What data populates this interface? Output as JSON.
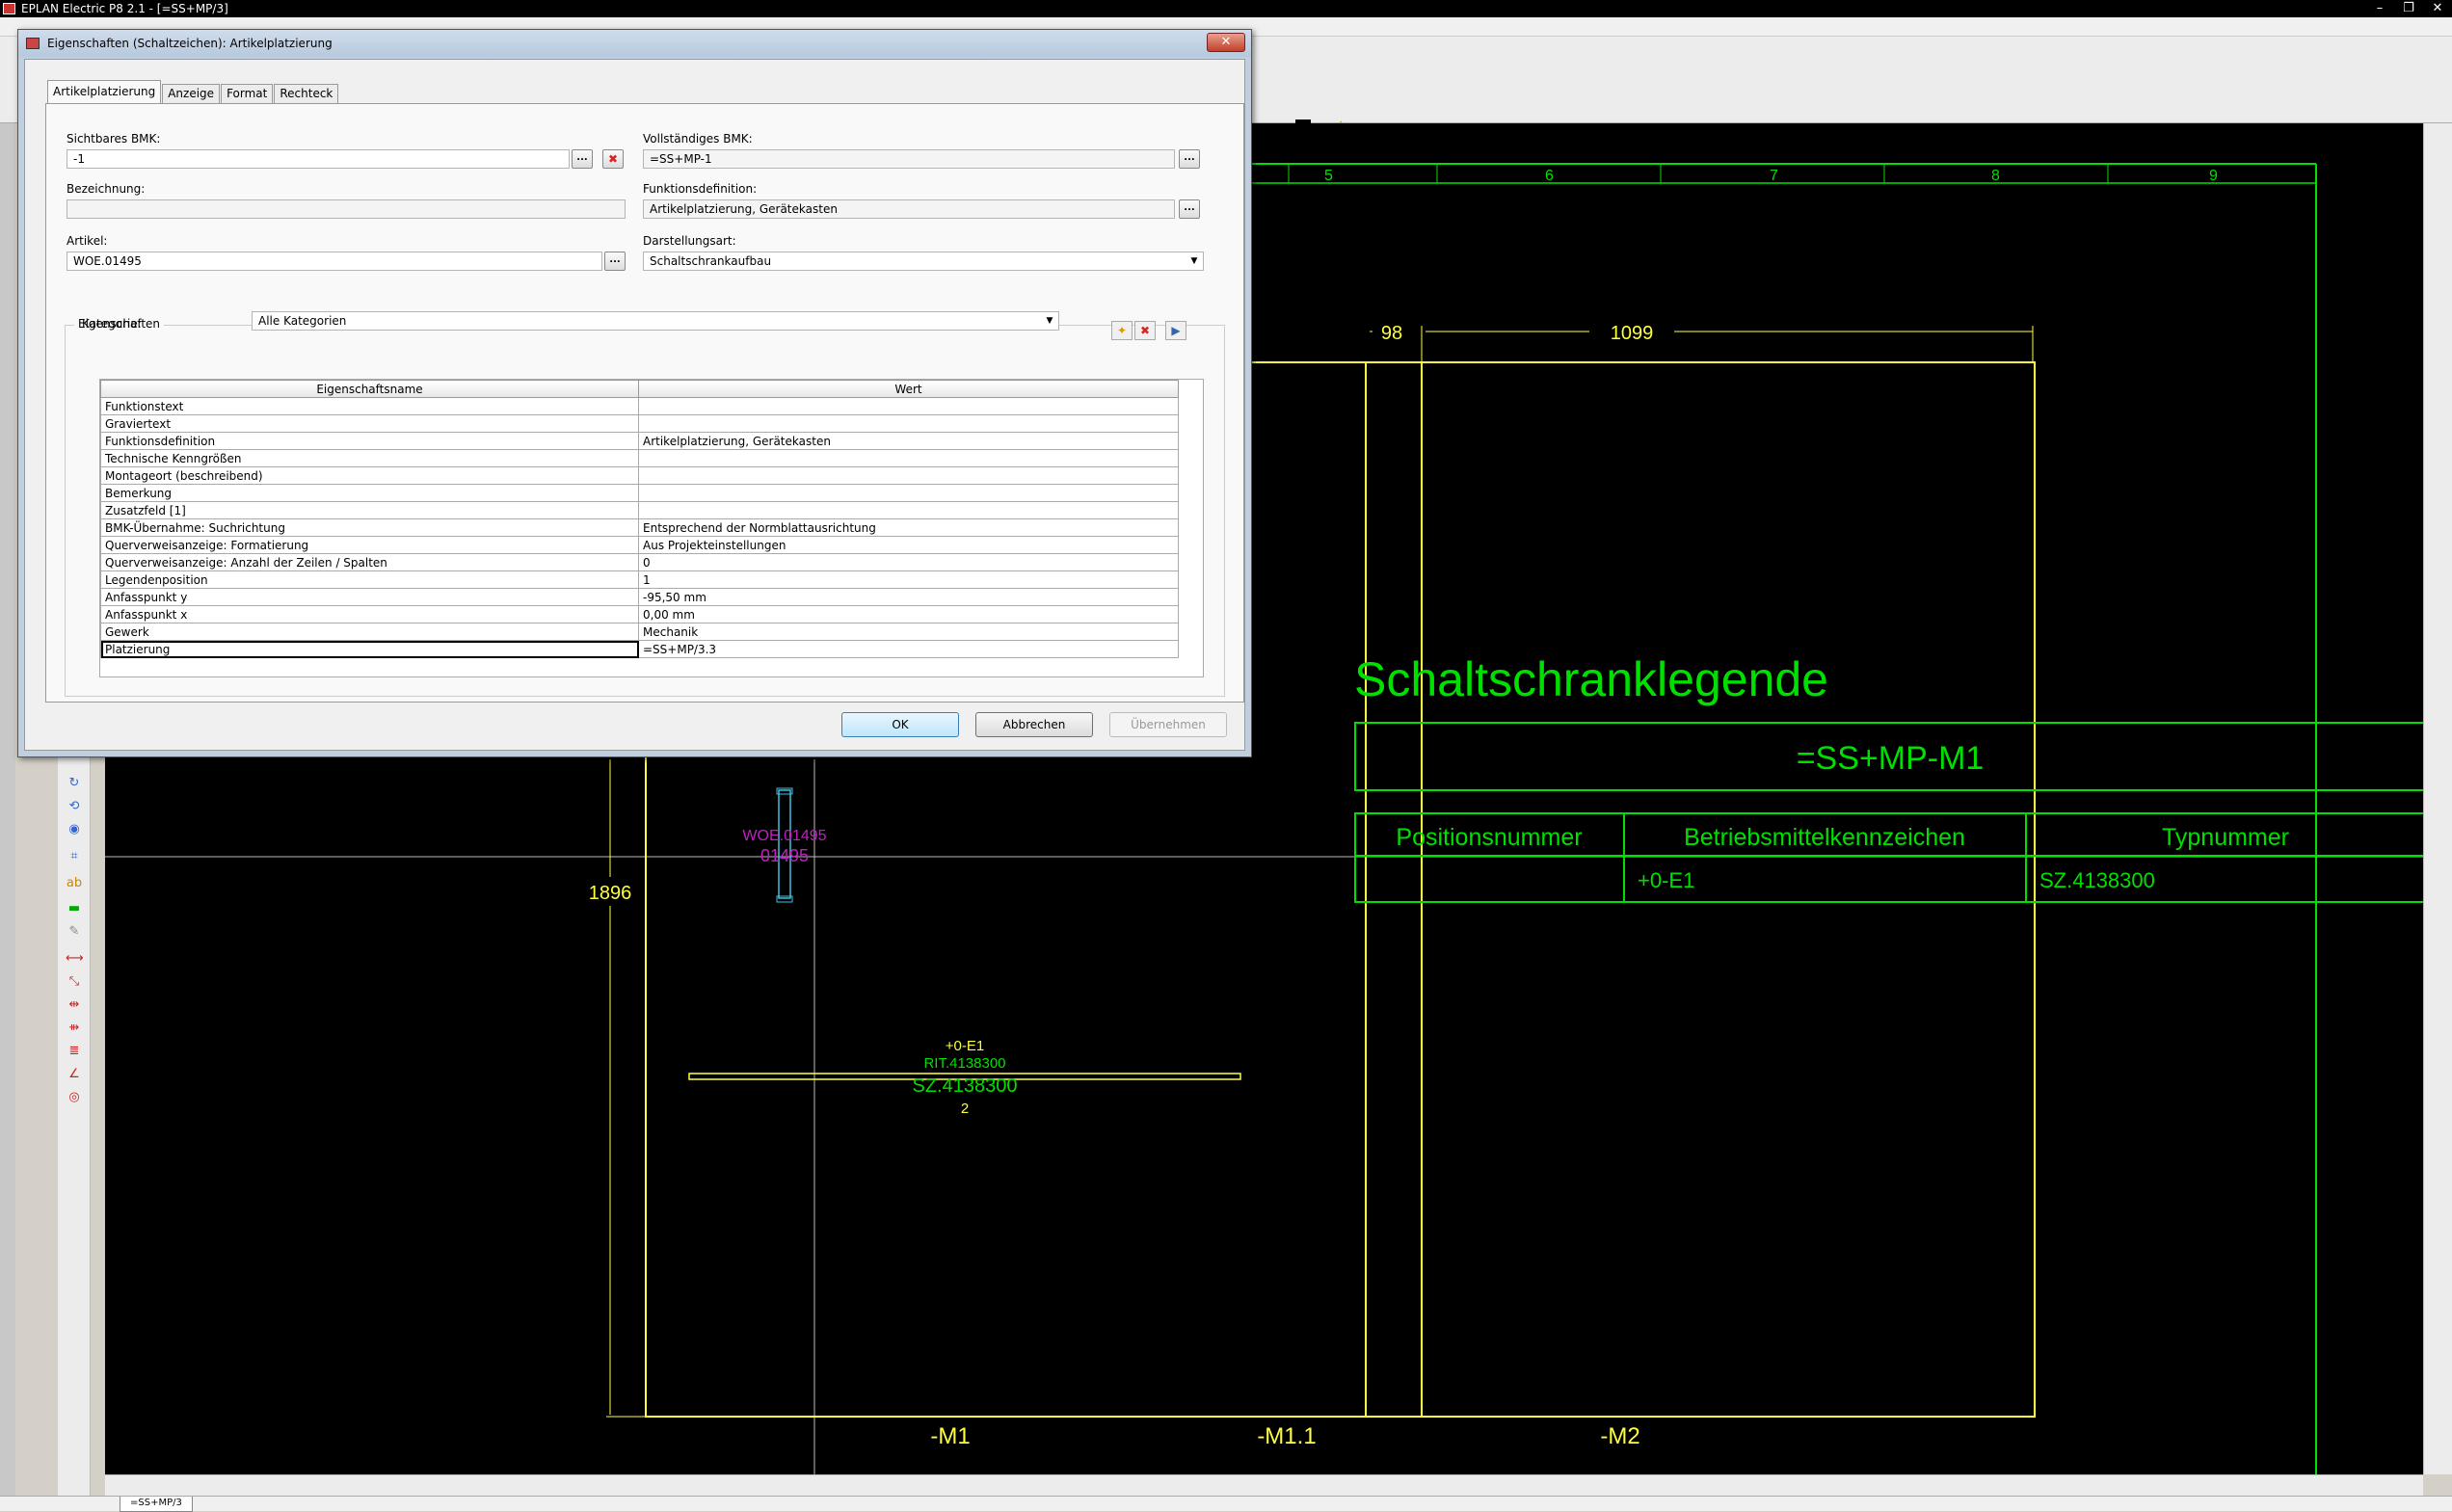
{
  "app": {
    "title": "EPLAN Electric P8 2.1 - [=SS+MP/3]",
    "status_tab": "=SS+MP/3",
    "window_buttons": [
      "–",
      "❐",
      "✕"
    ]
  },
  "dialog": {
    "title": "Eigenschaften (Schaltzeichen): Artikelplatzierung",
    "close_label": "✕",
    "tabs": [
      "Artikelplatzierung",
      "Anzeige",
      "Format",
      "Rechteck"
    ],
    "active_tab": "Artikelplatzierung",
    "fields": {
      "sichtbares_bmk_label": "Sichtbares BMK:",
      "sichtbares_bmk_value": "-1",
      "vollstaendiges_bmk_label": "Vollständiges BMK:",
      "vollstaendiges_bmk_value": "=SS+MP-1",
      "bezeichnung_label": "Bezeichnung:",
      "bezeichnung_value": "",
      "funktionsdefinition_label": "Funktionsdefinition:",
      "funktionsdefinition_value": "Artikelplatzierung, Gerätekasten",
      "artikel_label": "Artikel:",
      "artikel_value": "WOE.01495",
      "darstellungsart_label": "Darstellungsart:",
      "darstellungsart_value": "Schaltschrankaufbau",
      "browse_label": "..."
    },
    "properties": {
      "group_label": "Eigenschaften",
      "kategorie_label": "Kategorie:",
      "kategorie_value": "Alle Kategorien",
      "col_name": "Eigenschaftsname",
      "col_value": "Wert",
      "rows": [
        {
          "name": "Funktionstext",
          "value": ""
        },
        {
          "name": "Graviertext",
          "value": ""
        },
        {
          "name": "Funktionsdefinition",
          "value": "Artikelplatzierung, Gerätekasten"
        },
        {
          "name": "Technische Kenngrößen",
          "value": ""
        },
        {
          "name": "Montageort (beschreibend)",
          "value": ""
        },
        {
          "name": "Bemerkung",
          "value": ""
        },
        {
          "name": "Zusatzfeld [1]",
          "value": ""
        },
        {
          "name": "BMK-Übernahme: Suchrichtung",
          "value": "Entsprechend der Normblattausrichtung"
        },
        {
          "name": "Querverweisanzeige: Formatierung",
          "value": "Aus Projekteinstellungen"
        },
        {
          "name": "Querverweisanzeige: Anzahl der Zeilen / Spalten",
          "value": "0"
        },
        {
          "name": "Legendenposition",
          "value": "1"
        },
        {
          "name": "Anfasspunkt y",
          "value": "-95,50 mm"
        },
        {
          "name": "Anfasspunkt x",
          "value": "0,00 mm"
        },
        {
          "name": "Gewerk",
          "value": "Mechanik"
        },
        {
          "name": "Platzierung",
          "value": "=SS+MP/3.3"
        }
      ]
    },
    "buttons": {
      "ok": "OK",
      "cancel": "Abbrechen",
      "apply": "Übernehmen"
    }
  },
  "drawing": {
    "columns": [
      "5",
      "6",
      "7",
      "8",
      "9"
    ],
    "dim_98": "98",
    "dim_1099": "1099",
    "dim_1896": "1896",
    "legend_title": "Schaltschranklegende",
    "legend_location": "=SS+MP-M1",
    "legend_headers": [
      "Positionsnummer",
      "Betriebsmittelkennzeichen",
      "Typnummer"
    ],
    "legend_row": [
      "",
      "+0-E1",
      "SZ.4138300"
    ],
    "part_bmk": "+0-E1",
    "part_rit": "RIT.4138300",
    "part_sz": "SZ.4138300",
    "part_num": "2",
    "woe_label": "WOE.01495",
    "woe_label2": "01495",
    "labels_bottom": [
      "-M1",
      "-M1.1",
      "-M2"
    ],
    "colors": {
      "green": "#00e000",
      "yellow": "#ffff40",
      "magenta": "#c020c0",
      "cyan": "#40c0e0"
    }
  }
}
